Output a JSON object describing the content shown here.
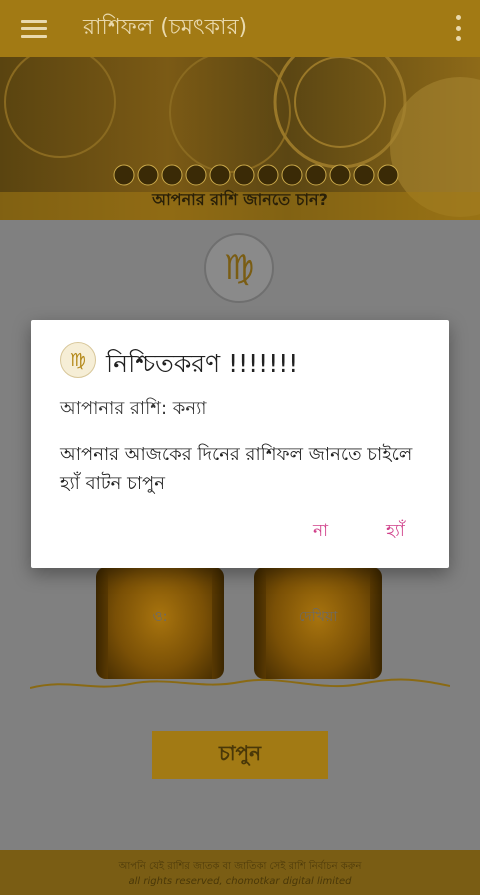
{
  "appbar": {
    "title": "রাশিফল (চমৎকার)"
  },
  "banner": {
    "caption": "আপনার রাশি জানতে চান?"
  },
  "reels": [
    {
      "text": "ও:"
    },
    {
      "text": "দেখিয়া"
    }
  ],
  "main_button": {
    "label": "চাপুন"
  },
  "footer": {
    "line1": "আপনি যেই রাশির জাতক বা জাতিকা সেই রাশি নির্বাচন করুন",
    "line2": "all rights reserved, chomotkar digital limited"
  },
  "dialog": {
    "title": "নিশ্চিতকরণ !!!!!!!",
    "zodiac_label": "আপানার রাশি: কন্যা",
    "message": "আপনার আজকের দিনের রাশিফল জানতে চাইলে হ্যাঁ বাটন চাপুন",
    "no_label": "না",
    "yes_label": "হ্যাঁ",
    "accent_color": "#d0408a"
  },
  "icons": [
    "menu-icon",
    "more-vert-icon",
    "virgo-icon"
  ]
}
